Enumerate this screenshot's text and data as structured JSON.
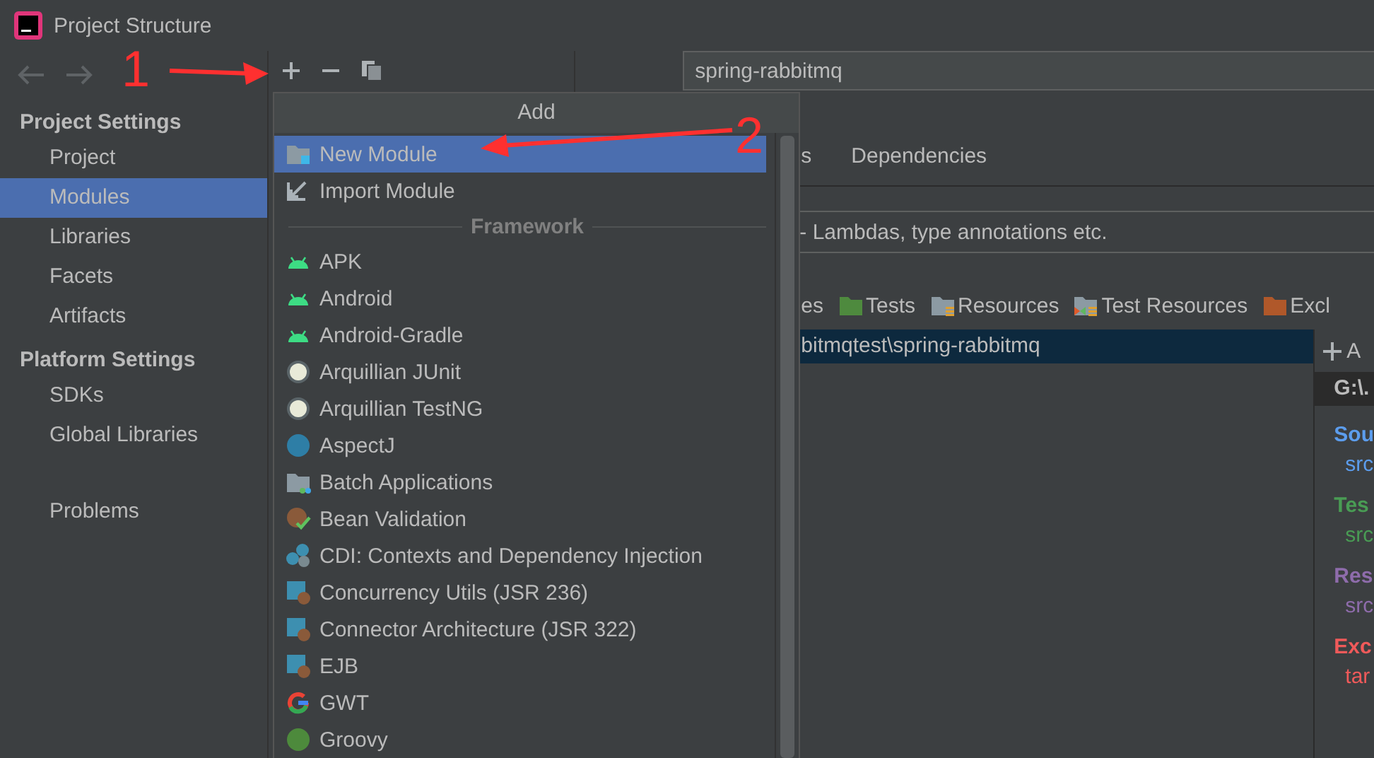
{
  "window": {
    "title": "Project Structure"
  },
  "sidebar": {
    "sections": [
      {
        "heading": "Project Settings",
        "items": [
          {
            "label": "Project",
            "selected": false
          },
          {
            "label": "Modules",
            "selected": true
          },
          {
            "label": "Libraries",
            "selected": false
          },
          {
            "label": "Facets",
            "selected": false
          },
          {
            "label": "Artifacts",
            "selected": false
          }
        ]
      },
      {
        "heading": "Platform Settings",
        "items": [
          {
            "label": "SDKs",
            "selected": false
          },
          {
            "label": "Global Libraries",
            "selected": false
          }
        ]
      },
      {
        "items": [
          {
            "label": "Problems",
            "selected": false
          }
        ]
      }
    ]
  },
  "module": {
    "name": "spring-rabbitmq",
    "tabs": [
      {
        "label": "s",
        "selected": false
      },
      {
        "label": "Dependencies",
        "selected": false
      }
    ],
    "language_level": "- Lambdas, type annotations etc.",
    "source_types": [
      {
        "kind": "plain",
        "label": "es"
      },
      {
        "kind": "tests",
        "label": "Tests"
      },
      {
        "kind": "resources",
        "label": "Resources"
      },
      {
        "kind": "test-resources",
        "label": "Test Resources"
      },
      {
        "kind": "excluded",
        "label": "Excl"
      }
    ],
    "content_root": {
      "path": "bitmqtest\\spring-rabbitmq",
      "selected": true
    },
    "roots_panel": {
      "add": "A",
      "root": "G:\\.",
      "sections": [
        {
          "heading": "Sou",
          "path": "src",
          "color": "#5c9ded"
        },
        {
          "heading": "Tes",
          "path": "src",
          "color": "#499c54"
        },
        {
          "heading": "Res",
          "path": "src",
          "color": "#8e6cab"
        },
        {
          "heading": "Exc",
          "path": "tar",
          "color": "#f05a5a"
        }
      ]
    }
  },
  "popup": {
    "title": "Add",
    "items": [
      {
        "kind": "item",
        "label": "New Module",
        "selected": true
      },
      {
        "kind": "item",
        "label": "Import Module",
        "selected": false
      },
      {
        "kind": "separator",
        "label": "Framework"
      },
      {
        "kind": "item",
        "label": "APK",
        "selected": false
      },
      {
        "kind": "item",
        "label": "Android",
        "selected": false
      },
      {
        "kind": "item",
        "label": "Android-Gradle",
        "selected": false
      },
      {
        "kind": "item",
        "label": "Arquillian JUnit",
        "selected": false
      },
      {
        "kind": "item",
        "label": "Arquillian TestNG",
        "selected": false
      },
      {
        "kind": "item",
        "label": "AspectJ",
        "selected": false
      },
      {
        "kind": "item",
        "label": "Batch Applications",
        "selected": false
      },
      {
        "kind": "item",
        "label": "Bean Validation",
        "selected": false
      },
      {
        "kind": "item",
        "label": "CDI: Contexts and Dependency Injection",
        "selected": false
      },
      {
        "kind": "item",
        "label": "Concurrency Utils (JSR 236)",
        "selected": false
      },
      {
        "kind": "item",
        "label": "Connector Architecture (JSR 322)",
        "selected": false
      },
      {
        "kind": "item",
        "label": "EJB",
        "selected": false
      },
      {
        "kind": "item",
        "label": "GWT",
        "selected": false
      },
      {
        "kind": "item",
        "label": "Groovy",
        "selected": false
      }
    ]
  },
  "annotations": [
    {
      "label": "1"
    },
    {
      "label": "2"
    }
  ]
}
